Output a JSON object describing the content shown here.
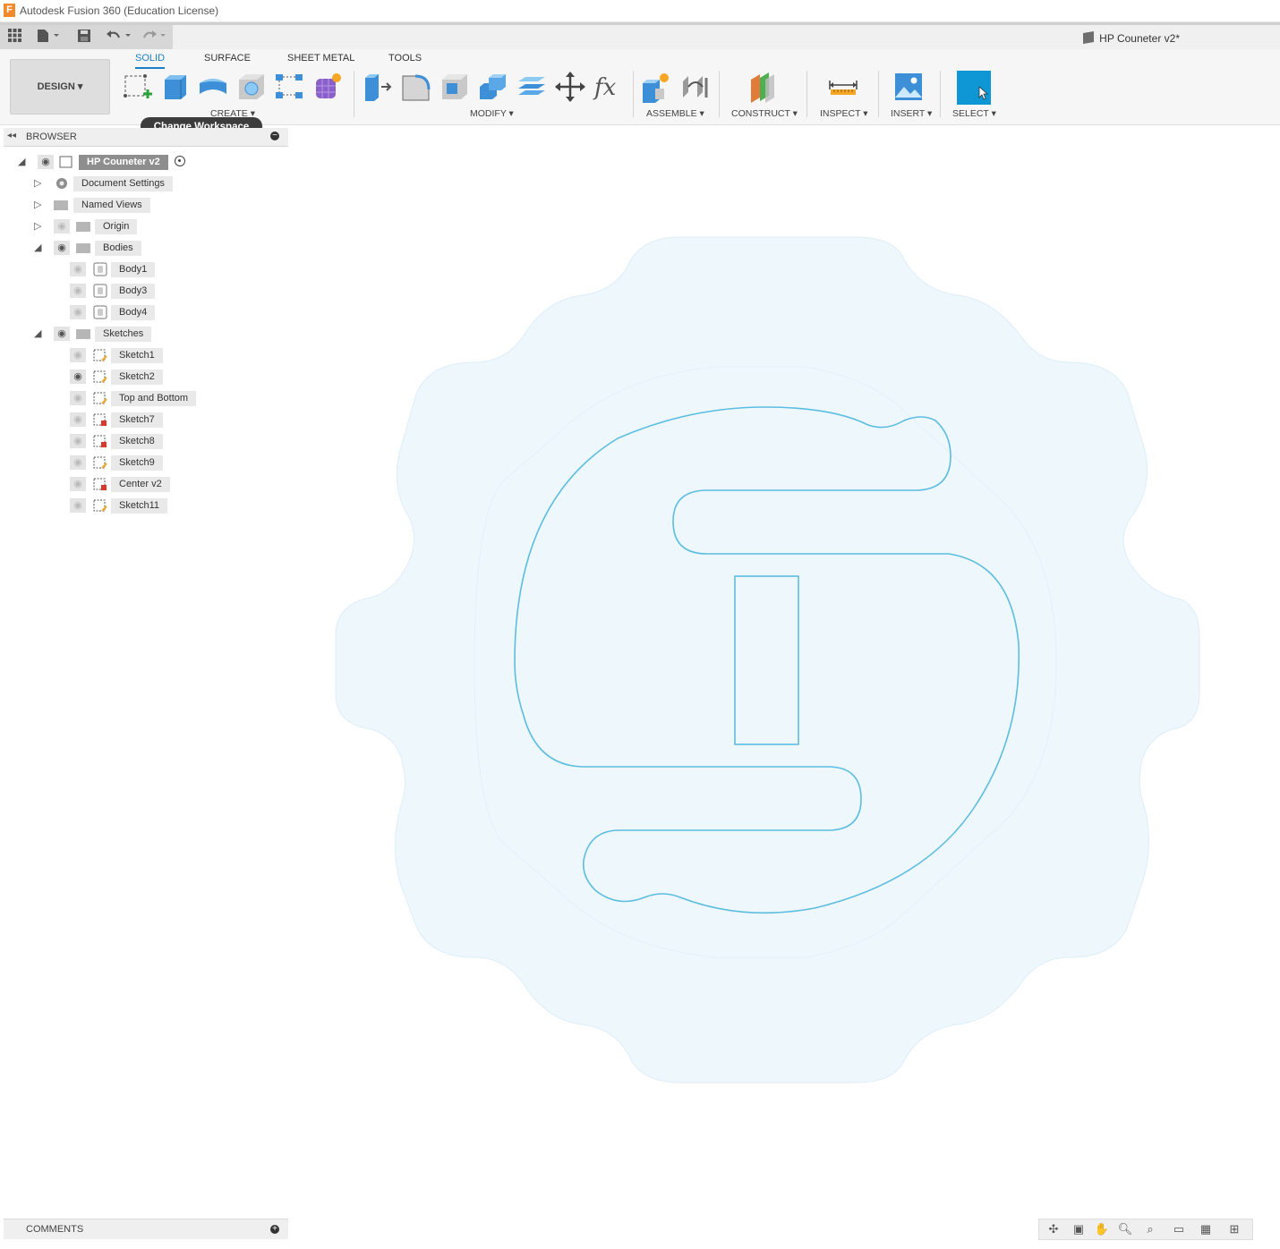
{
  "app": {
    "title": "Autodesk Fusion 360 (Education License)",
    "icon_letter": "F"
  },
  "document": {
    "name": "HP Couneter v2*"
  },
  "workspace": {
    "label": "DESIGN ▾"
  },
  "tabs": [
    "SOLID",
    "SURFACE",
    "SHEET METAL",
    "TOOLS"
  ],
  "groups": {
    "create": "CREATE ▾",
    "modify": "MODIFY ▾",
    "assemble": "ASSEMBLE ▾",
    "construct": "CONSTRUCT ▾",
    "inspect": "INSPECT ▾",
    "insert": "INSERT ▾",
    "select": "SELECT ▾"
  },
  "tooltip": "Change Workspace",
  "browser": {
    "title": "BROWSER",
    "root": "HP Couneter v2",
    "items": [
      {
        "label": "Document Settings"
      },
      {
        "label": "Named Views"
      },
      {
        "label": "Origin"
      },
      {
        "label": "Bodies"
      },
      {
        "label": "Body1"
      },
      {
        "label": "Body3"
      },
      {
        "label": "Body4"
      },
      {
        "label": "Sketches"
      },
      {
        "label": "Sketch1"
      },
      {
        "label": "Sketch2"
      },
      {
        "label": "Top and Bottom"
      },
      {
        "label": "Sketch7"
      },
      {
        "label": "Sketch8"
      },
      {
        "label": "Sketch9"
      },
      {
        "label": "Center v2"
      },
      {
        "label": "Sketch11"
      }
    ]
  },
  "comments": {
    "title": "COMMENTS"
  },
  "colors": {
    "accent": "#1a7fc6",
    "sketch_line": "#5bbde0",
    "body_fill": "#eef7fc",
    "select_blue": "#0f96d4"
  }
}
